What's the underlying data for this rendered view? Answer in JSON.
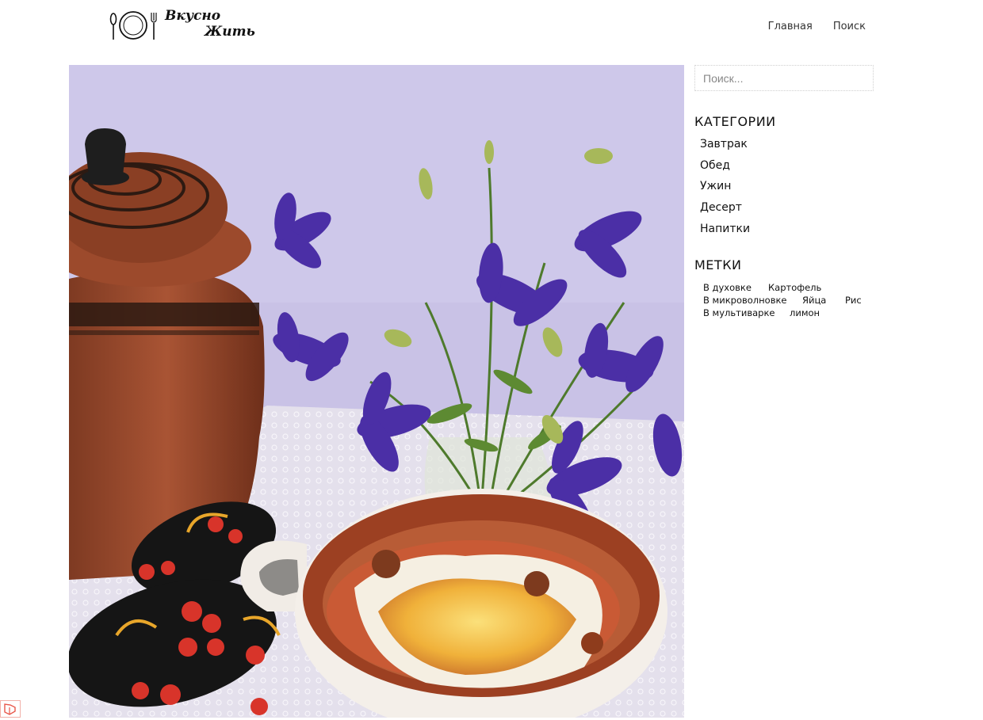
{
  "brand": {
    "logo_line1": "Вкусно",
    "logo_line2": "Жить"
  },
  "nav": [
    {
      "label": "Главная"
    },
    {
      "label": "Поиск"
    }
  ],
  "sidebar": {
    "search_placeholder": "Поиск...",
    "categories_title": "КАТЕГОРИИ",
    "categories": [
      {
        "label": "Завтрак"
      },
      {
        "label": "Обед"
      },
      {
        "label": "Ужин"
      },
      {
        "label": "Десерт"
      },
      {
        "label": "Напитки"
      }
    ],
    "tags_title": "МЕТКИ",
    "tags": [
      {
        "label": "В духовке"
      },
      {
        "label": "Картофель"
      },
      {
        "label": "В микроволновке"
      },
      {
        "label": "Яйца"
      },
      {
        "label": "Рис"
      },
      {
        "label": "В мультиварке"
      },
      {
        "label": "лимон"
      }
    ]
  },
  "colors": {
    "wall": "#c9c2e6",
    "pot": "#9c4a2c",
    "flower": "#4b2fa6",
    "cheese": "#f0b13a"
  },
  "icons": {
    "logo": "plate-fork-spoon-icon",
    "corner": "framework-logo-icon"
  }
}
